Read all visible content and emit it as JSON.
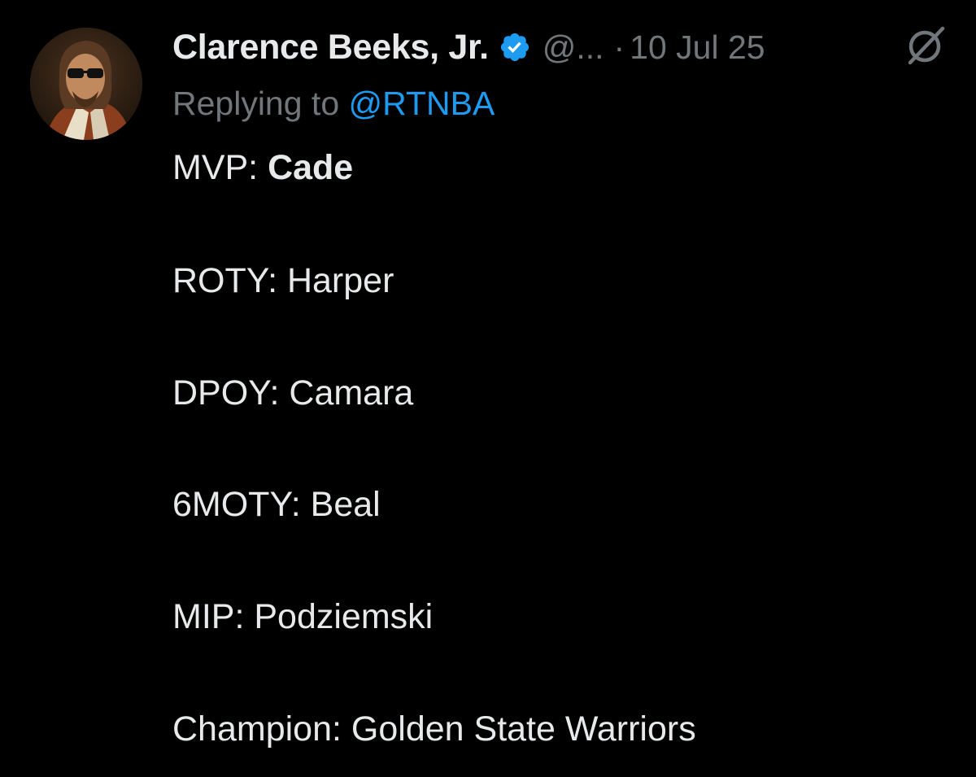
{
  "tweet": {
    "author": {
      "display_name": "Clarence Beeks, Jr.",
      "handle": "@...",
      "verified": true,
      "avatar": "avatar-photo"
    },
    "separator": "·",
    "timestamp": "10 Jul 25",
    "replying_prefix": "Replying to ",
    "replying_to": "@RTNBA",
    "lines": [
      {
        "label": "MVP: ",
        "value": "Cade"
      },
      {
        "label": "ROTY: ",
        "value": "Harper"
      },
      {
        "label": "DPOY: ",
        "value": "Camara"
      },
      {
        "label": "6MOTY: ",
        "value": "Beal"
      },
      {
        "label": "MIP: ",
        "value": "Podziemski"
      },
      {
        "label": "Champion: ",
        "value": "Golden State Warriors"
      }
    ]
  },
  "icons": {
    "verified": "verified-badge-icon",
    "grok": "grok-icon"
  },
  "colors": {
    "background": "#000000",
    "primary_text": "#e7e9ea",
    "secondary_text": "#71767b",
    "accent": "#1d9bf0"
  }
}
